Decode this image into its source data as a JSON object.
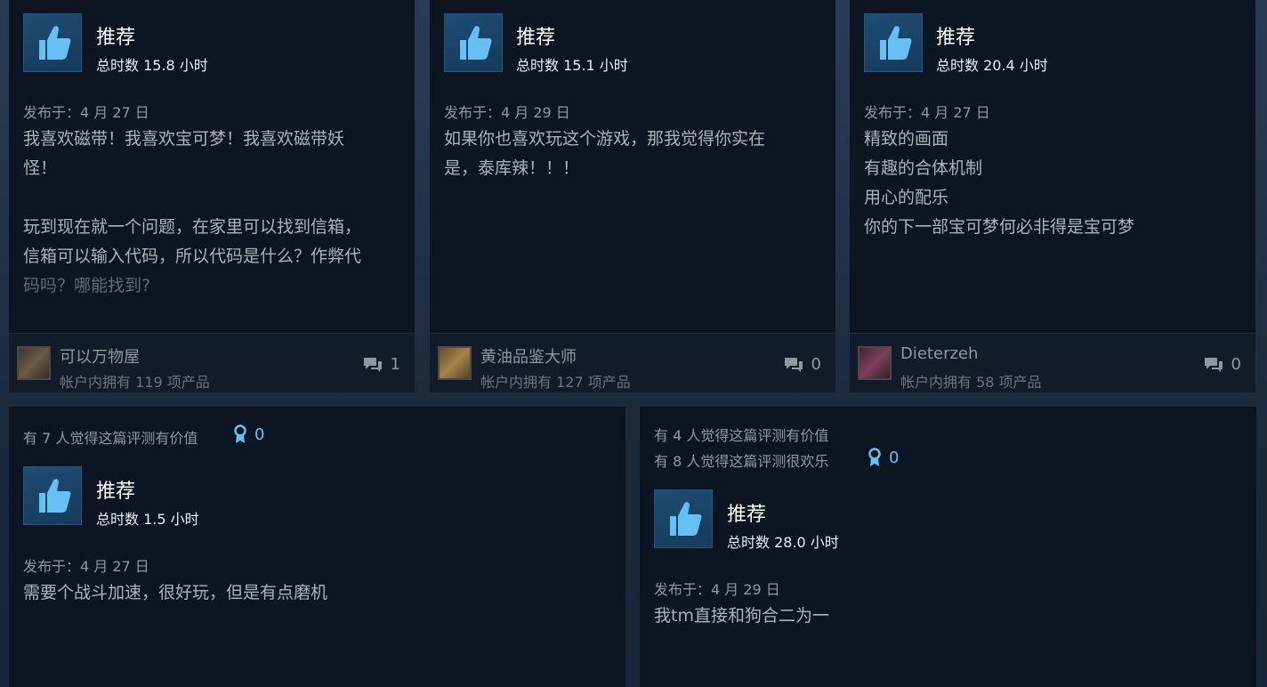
{
  "reviews": [
    {
      "label": "推荐",
      "hours": "总时数 15.8 小时",
      "posted": "发布于：4 月 27 日",
      "body": "我喜欢磁带！我喜欢宝可梦！我喜欢磁带妖\n怪！\n\n玩到现在就一个问题，在家里可以找到信箱，\n信箱可以输入代码，所以代码是什么？作弊代",
      "body_fade": "码吗？哪能找到?",
      "user": "可以万物屋",
      "owned": "帐户内拥有 119 项产品",
      "comments": "1",
      "avatar_color": "#5a5040"
    },
    {
      "label": "推荐",
      "hours": "总时数 15.1 小时",
      "posted": "发布于：4 月 29 日",
      "body": "如果你也喜欢玩这个游戏，那我觉得你实在\n是，泰库辣！！！",
      "user": "黄油品鉴大师",
      "owned": "帐户内拥有 127 项产品",
      "comments": "0",
      "avatar_color": "#8a6d3b"
    },
    {
      "label": "推荐",
      "hours": "总时数 20.4 小时",
      "posted": "发布于：4 月 27 日",
      "body": "精致的画面\n有趣的合体机制\n用心的配乐\n你的下一部宝可梦何必非得是宝可梦",
      "user": "Dieterzeh",
      "owned": "帐户内拥有 58 项产品",
      "comments": "0",
      "avatar_color": "#6a3a4a"
    },
    {
      "helpful": "有 7 人觉得这篇评测有价值",
      "awards": "0",
      "label": "推荐",
      "hours": "总时数 1.5 小时",
      "posted": "发布于：4 月 27 日",
      "body": "需要个战斗加速，很好玩，但是有点磨机"
    },
    {
      "helpful": "有 4 人觉得这篇评测有价值",
      "funny": "有 8 人觉得这篇评测很欢乐",
      "awards": "0",
      "label": "推荐",
      "hours": "总时数 28.0 小时",
      "posted": "发布于：4 月 29 日",
      "body": "我tm直接和狗合二为一"
    }
  ],
  "colors": {
    "background": "#1c2a3c",
    "card": "#0d1523",
    "accent": "#66c0f4",
    "thumb": "#1e4d74"
  },
  "icons": {
    "thumb": "thumbs-up-icon",
    "comment": "comment-bubble-icon",
    "award": "award-ribbon-icon"
  }
}
